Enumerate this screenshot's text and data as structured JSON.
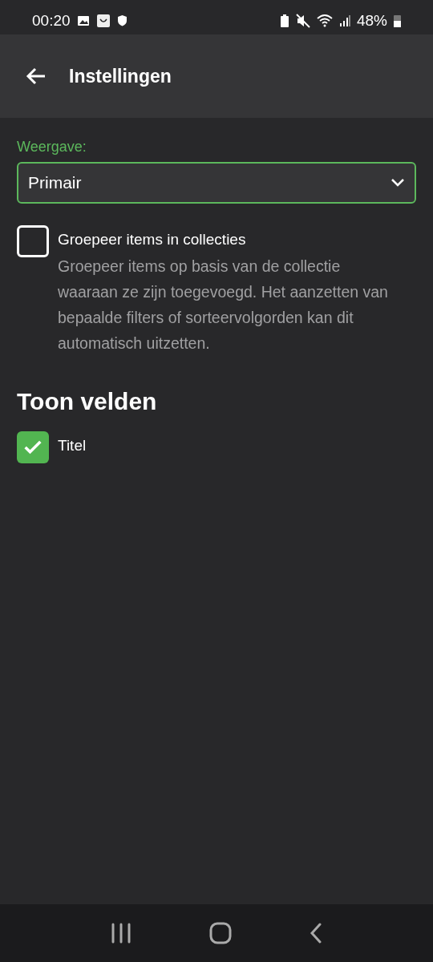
{
  "status_bar": {
    "time": "00:20",
    "battery": "48%"
  },
  "app_bar": {
    "title": "Instellingen"
  },
  "display": {
    "label": "Weergave:",
    "value": "Primair"
  },
  "group_option": {
    "label": "Groepeer items in collecties",
    "checked": false,
    "description": "Groepeer items op basis van de collectie waaraan ze zijn toegevoegd. Het aanzetten van bepaalde filters of sorteervolgorden kan dit automatisch uitzetten."
  },
  "fields_section": {
    "heading": "Toon velden",
    "fields": [
      {
        "label": "Titel",
        "checked": true
      }
    ]
  }
}
